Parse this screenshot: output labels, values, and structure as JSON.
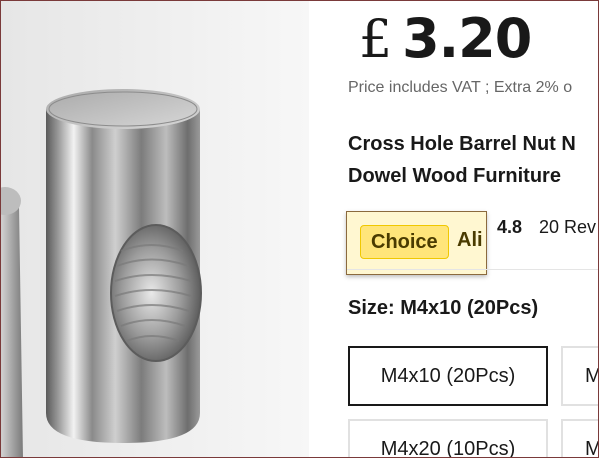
{
  "price": {
    "currency": "£",
    "amount": "3.20"
  },
  "vat_note": "Price includes VAT ; Extra 2% o",
  "title": {
    "line1": "Cross Hole Barrel Nut N",
    "line2": "Dowel Wood Furniture"
  },
  "choice": {
    "badge": "Choice",
    "suffix": "Ali"
  },
  "rating": {
    "value": "4.8",
    "reviews": "20 Rev"
  },
  "size": {
    "label": "Size: M4x10 (20Pcs)",
    "options": [
      {
        "label": "M4x10 (20Pcs)",
        "selected": true
      },
      {
        "label": "M",
        "selected": false
      },
      {
        "label": "M4x20 (10Pcs)",
        "selected": false
      },
      {
        "label": "M",
        "selected": false
      }
    ]
  },
  "colors": {
    "text": "#191919",
    "muted": "#666666",
    "choice_bg": "#ffe57a",
    "frame": "#7a3a3a"
  },
  "icons": {
    "product": "product-image-barrel-nut"
  }
}
